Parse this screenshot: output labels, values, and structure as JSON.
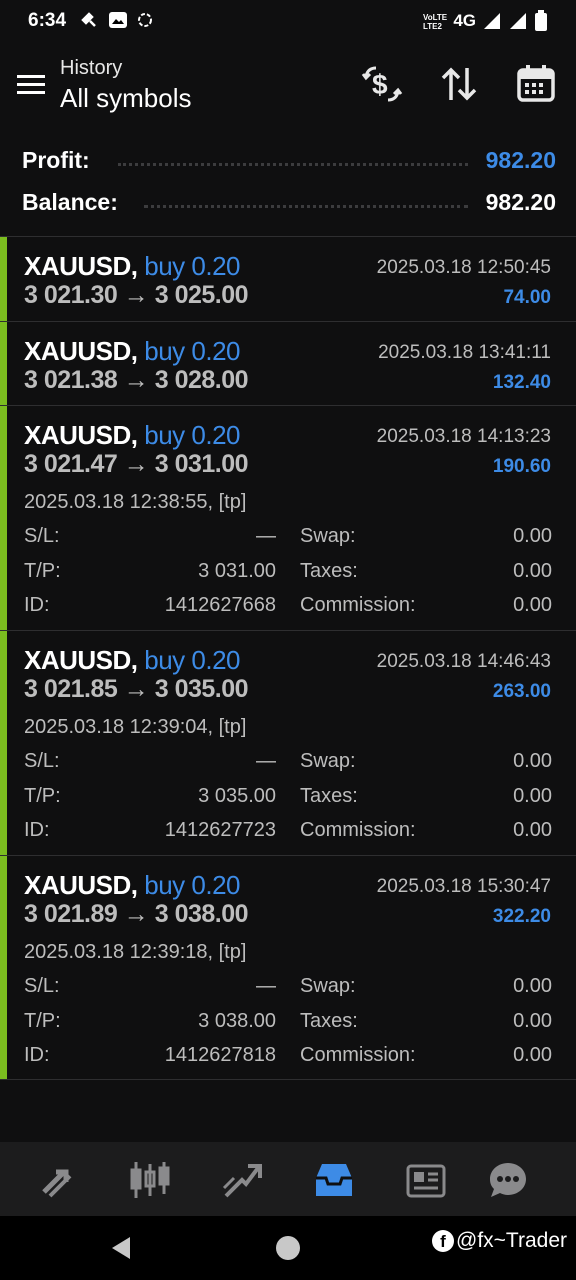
{
  "status_bar": {
    "time": "6:34",
    "network": "4G"
  },
  "header": {
    "subtitle": "History",
    "title": "All symbols"
  },
  "summary": {
    "profit_label": "Profit:",
    "profit_value": "982.20",
    "balance_label": "Balance:",
    "balance_value": "982.20"
  },
  "colors": {
    "accent_blue": "#3d8be6",
    "buy_bar_green": "#7bbd1f",
    "background": "#0f0f10"
  },
  "deals": [
    {
      "symbol": "XAUUSD,",
      "type": "buy 0.20",
      "open_price": "3 021.30",
      "arrow": "→",
      "close_price": "3 025.00",
      "close_time": "2025.03.18 12:50:45",
      "profit": "74.00"
    },
    {
      "symbol": "XAUUSD,",
      "type": "buy 0.20",
      "open_price": "3 021.38",
      "arrow": "→",
      "close_price": "3 028.00",
      "close_time": "2025.03.18 13:41:11",
      "profit": "132.40"
    },
    {
      "symbol": "XAUUSD,",
      "type": "buy 0.20",
      "open_price": "3 021.47",
      "arrow": "→",
      "close_price": "3 031.00",
      "close_time": "2025.03.18 14:13:23",
      "profit": "190.60",
      "open_time": "2025.03.18 12:38:55, [tp]",
      "sl_label": "S/L:",
      "sl": "—",
      "swap_label": "Swap:",
      "swap": "0.00",
      "tp_label": "T/P:",
      "tp": "3 031.00",
      "taxes_label": "Taxes:",
      "taxes": "0.00",
      "id_label": "ID:",
      "id": "1412627668",
      "commission_label": "Commission:",
      "commission": "0.00"
    },
    {
      "symbol": "XAUUSD,",
      "type": "buy 0.20",
      "open_price": "3 021.85",
      "arrow": "→",
      "close_price": "3 035.00",
      "close_time": "2025.03.18 14:46:43",
      "profit": "263.00",
      "open_time": "2025.03.18 12:39:04, [tp]",
      "sl_label": "S/L:",
      "sl": "—",
      "swap_label": "Swap:",
      "swap": "0.00",
      "tp_label": "T/P:",
      "tp": "3 035.00",
      "taxes_label": "Taxes:",
      "taxes": "0.00",
      "id_label": "ID:",
      "id": "1412627723",
      "commission_label": "Commission:",
      "commission": "0.00"
    },
    {
      "symbol": "XAUUSD,",
      "type": "buy 0.20",
      "open_price": "3 021.89",
      "arrow": "→",
      "close_price": "3 038.00",
      "close_time": "2025.03.18 15:30:47",
      "profit": "322.20",
      "open_time": "2025.03.18 12:39:18, [tp]",
      "sl_label": "S/L:",
      "sl": "—",
      "swap_label": "Swap:",
      "swap": "0.00",
      "tp_label": "T/P:",
      "tp": "3 038.00",
      "taxes_label": "Taxes:",
      "taxes": "0.00",
      "id_label": "ID:",
      "id": "1412627818",
      "commission_label": "Commission:",
      "commission": "0.00"
    }
  ],
  "bottom_nav": {
    "items": [
      "quotes-icon",
      "chart-icon",
      "trade-icon",
      "history-icon",
      "news-icon",
      "chat-icon"
    ],
    "active": "history-icon"
  },
  "watermark": {
    "text": "@fx~Trader"
  }
}
